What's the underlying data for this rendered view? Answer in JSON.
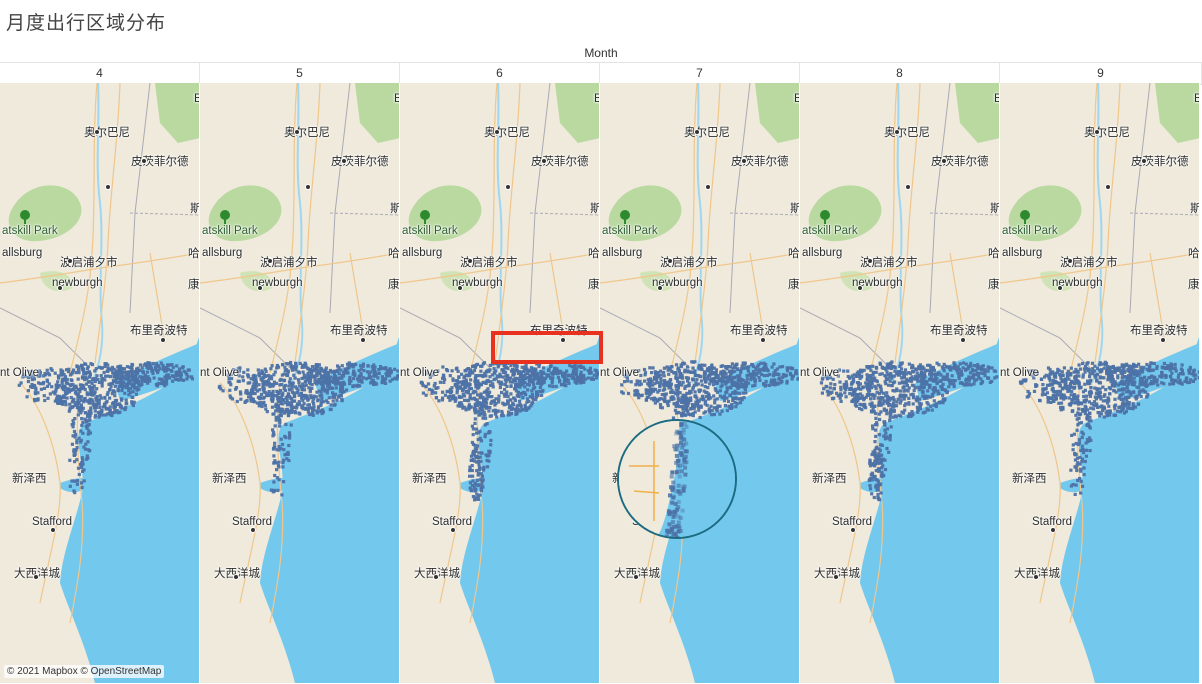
{
  "title": "月度出行区域分布",
  "column_dimension": "Month",
  "months": [
    "4",
    "5",
    "6",
    "7",
    "8",
    "9"
  ],
  "map_labels": {
    "albany": "奥尔巴尼",
    "pittsfield": "皮茨菲尔德",
    "catskill_park": "atskill Park",
    "saugerties": "allsburg",
    "poughkeepsie": "波启浦夕市",
    "newburgh": "newburgh",
    "bridgeport": "布里奇波特",
    "mount_olive": "nt Olive",
    "new_jersey": "新泽西",
    "stafford": "Stafford",
    "atlantic_city": "大西洋城",
    "edge_right_1": "斯",
    "edge_right_2": "哈",
    "edge_right_3": "康",
    "edge_right_top": "B"
  },
  "attribution": "© 2021 Mapbox © OpenStreetMap",
  "colors": {
    "land": "#efeadb",
    "water": "#73c8ee",
    "forest": "#b9d9a0",
    "trips": "#4c72a6",
    "highlight": "#e8321f",
    "zoom_ring": "#1c6b80"
  },
  "icons": [
    "tree-icon",
    "city-dot-icon"
  ]
}
